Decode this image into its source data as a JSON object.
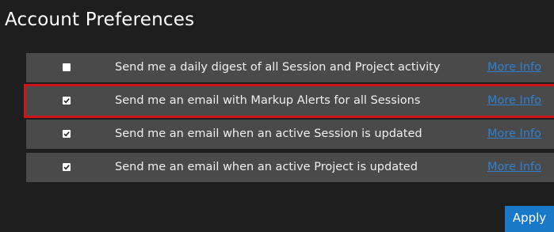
{
  "page": {
    "title": "Account Preferences"
  },
  "colors": {
    "row_background": "#4a4a4a",
    "highlight_border": "#d0141a",
    "link": "#2f7fd0",
    "apply_button": "#1a78c8"
  },
  "preferences": [
    {
      "label": "Send me a daily digest of all Session and Project activity",
      "checked": false,
      "link_text": "More Info",
      "highlighted": false
    },
    {
      "label": "Send me an email with Markup Alerts for all Sessions",
      "checked": true,
      "link_text": "More Info",
      "highlighted": true
    },
    {
      "label": "Send me an email when an active Session is updated",
      "checked": true,
      "link_text": "More Info",
      "highlighted": false
    },
    {
      "label": "Send me an email when an active Project is updated",
      "checked": true,
      "link_text": "More Info",
      "highlighted": false
    }
  ],
  "actions": {
    "apply_label": "Apply"
  }
}
